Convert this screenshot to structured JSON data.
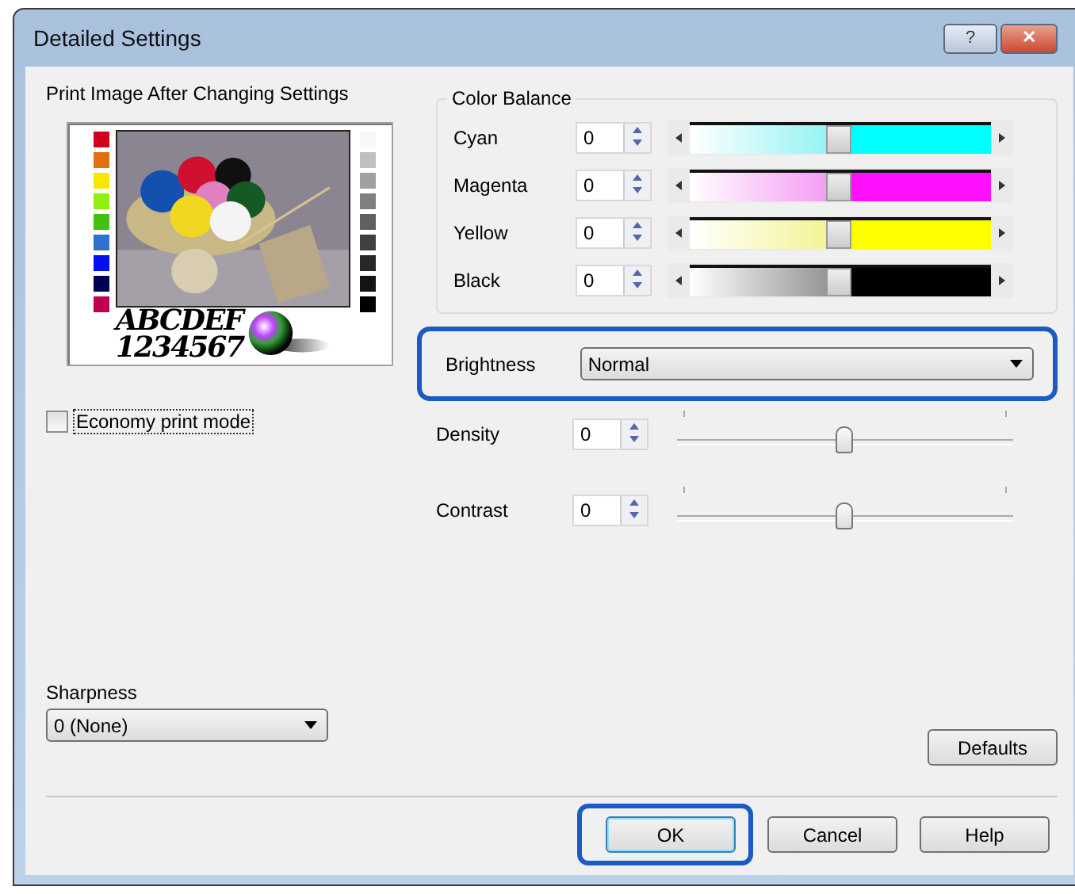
{
  "window": {
    "title": "Detailed Settings",
    "title_buttons": [
      "?",
      "✕"
    ]
  },
  "preview": {
    "label": "Print Image After Changing Settings",
    "sample_text": [
      "ABCDEF",
      "1234567"
    ]
  },
  "economy": {
    "label": "Economy print mode",
    "checked": false
  },
  "color_balance": {
    "title": "Color Balance",
    "rows": [
      {
        "label": "Cyan",
        "value": "0",
        "level": 0.5,
        "color": "#00ffff"
      },
      {
        "label": "Magenta",
        "value": "0",
        "level": 0.5,
        "color": "#ff10ff"
      },
      {
        "label": "Yellow",
        "value": "0",
        "level": 0.5,
        "color": "#ffff00"
      },
      {
        "label": "Black",
        "value": "0",
        "level": 0.5,
        "color": "#000000"
      }
    ]
  },
  "brightness": {
    "label": "Brightness",
    "value": "Normal",
    "highlighted": true
  },
  "sliders": [
    {
      "label": "Density",
      "value": "0",
      "level": 0.5
    },
    {
      "label": "Contrast",
      "value": "0",
      "level": 0.5
    }
  ],
  "sharpness": {
    "label": "Sharpness",
    "value": "0 (None)"
  },
  "buttons": [
    {
      "label": "Defaults",
      "highlighted": false
    },
    {
      "label": "OK",
      "highlighted": true
    },
    {
      "label": "Cancel",
      "highlighted": false
    },
    {
      "label": "Help",
      "highlighted": false
    }
  ]
}
